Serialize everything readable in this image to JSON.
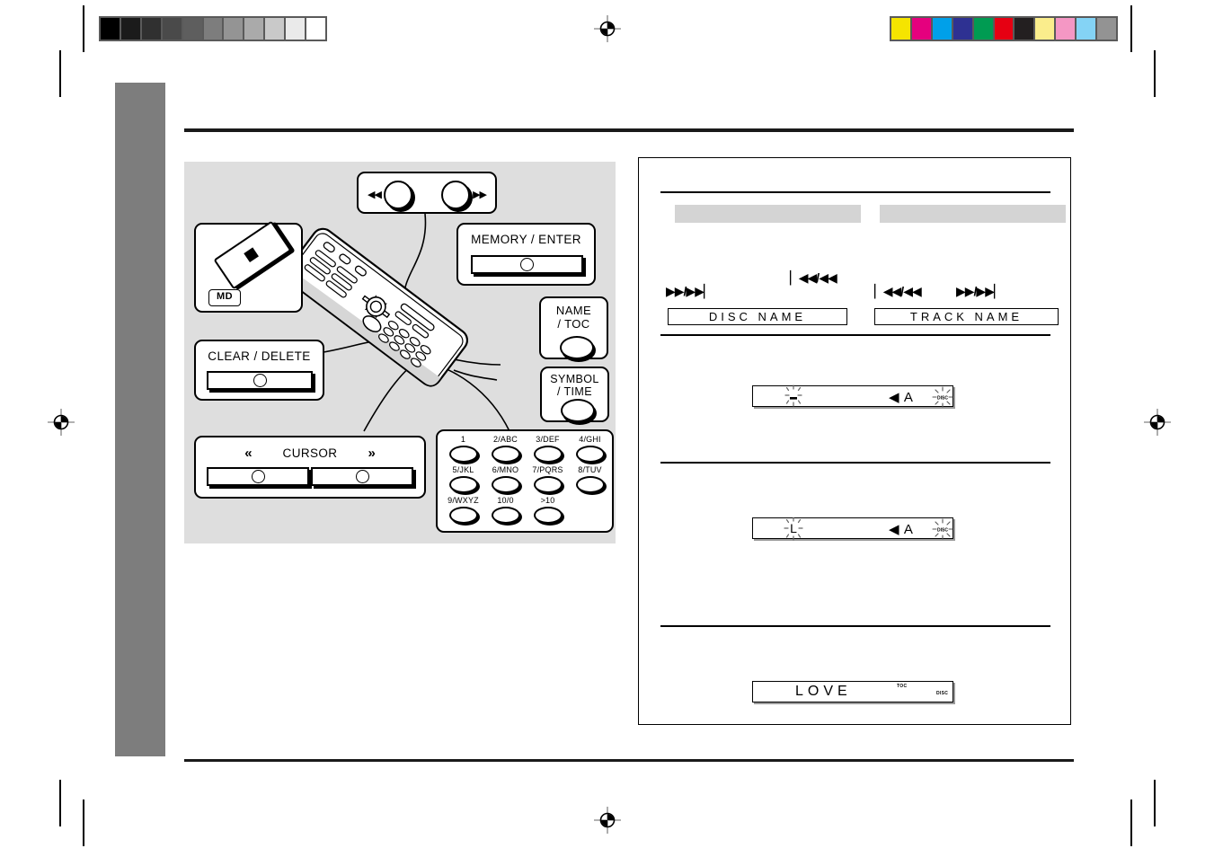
{
  "page": {
    "kind": "scanned-manual-page",
    "registration_marks": 4,
    "crop_marks": 4
  },
  "calibration": {
    "gray_strip": {
      "name": "grayscale-calibration-strip",
      "swatches": [
        "#000000",
        "#1b1b1b",
        "#303030",
        "#4a4a4a",
        "#5e5e5e",
        "#7d7d7d",
        "#949494",
        "#aaaaaa",
        "#c9c9c9",
        "#eaeaea",
        "#ffffff"
      ]
    },
    "color_strip": {
      "name": "color-calibration-strip",
      "swatches": [
        "#f5e400",
        "#e5007e",
        "#00a0e9",
        "#2e3192",
        "#009b52",
        "#e60012",
        "#231f20",
        "#faed8c",
        "#f497c4",
        "#84d3f5",
        "#939393"
      ]
    }
  },
  "figure": {
    "title": "remote-control-callout-diagram",
    "callouts": {
      "md": {
        "label": "MD"
      },
      "skip": {
        "left_symbol": "◀◀",
        "right_symbol": "▶▶"
      },
      "memory_enter": {
        "label": "MEMORY / ENTER"
      },
      "clear_delete": {
        "label": "CLEAR / DELETE"
      },
      "cursor": {
        "label": "CURSOR",
        "left_symbol": "«",
        "right_symbol": "»"
      },
      "name_toc": {
        "line1": "NAME",
        "line2": "/ TOC"
      },
      "symbol_time": {
        "line1": "SYMBOL",
        "line2": "/ TIME"
      }
    },
    "keypad": {
      "rows": [
        [
          "1",
          "2/ABC",
          "3/DEF",
          "4/GHI"
        ],
        [
          "5/JKL",
          "6/MNO",
          "7/PQRS",
          "8/TUV"
        ],
        [
          "9/WXYZ",
          "10/0",
          ">10"
        ]
      ]
    }
  },
  "content": {
    "headers": {
      "left": "",
      "right": ""
    },
    "transport_symbols": {
      "left_forward": "▶▶/▶▶▏",
      "left_reverse": "▏◀◀/◀◀",
      "right_reverse": "▏◀◀/◀◀",
      "right_forward": "▶▶/▶▶▏"
    },
    "mode_boxes": {
      "disc": "DISC NAME",
      "track": "TRACK NAME"
    },
    "displays": [
      {
        "name": "lcd-display-blank-cursor",
        "main_text": "",
        "cursor": "_",
        "cursor_blinking": true,
        "mode_marker": "◀ A",
        "indicator": "DISC",
        "indicator_blinking": true
      },
      {
        "name": "lcd-display-letter-l",
        "main_text": "L",
        "cursor": "",
        "cursor_blinking": true,
        "mode_marker": "◀ A",
        "indicator": "DISC",
        "indicator_blinking": true
      },
      {
        "name": "lcd-display-love",
        "main_text": "LOVE",
        "cursor": "",
        "cursor_blinking": false,
        "mode_marker": "",
        "indicator": "DISC",
        "indicator_secondary": "TOC",
        "indicator_blinking": false
      }
    ]
  },
  "colors": {
    "side_tab": "#7d7d7d",
    "figure_bg": "#dedede",
    "header_bar": "#d4d4d4",
    "rule": "#1a1a1a"
  }
}
